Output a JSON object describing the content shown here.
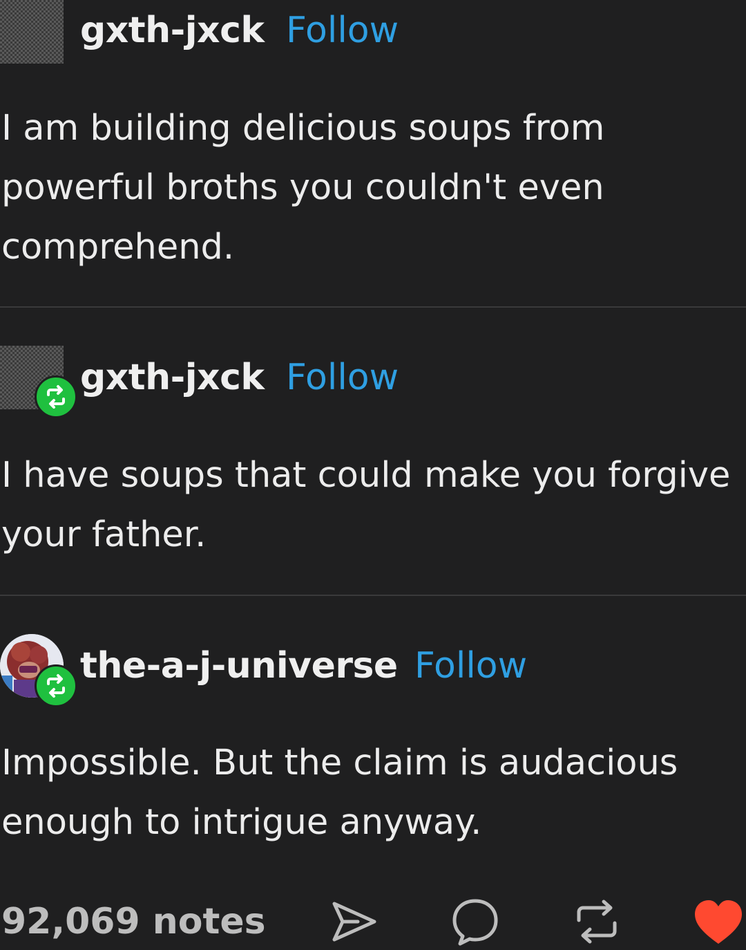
{
  "posts": [
    {
      "username": "gxth-jxck",
      "follow_label": "Follow",
      "text": "I am building delicious soups from powerful broths you couldn't even comprehend."
    },
    {
      "username": "gxth-jxck",
      "follow_label": "Follow",
      "text": "I have soups that could make you forgive your father."
    },
    {
      "username": "the-a-j-universe",
      "follow_label": "Follow",
      "text": "Impossible. But the claim is audacious enough to intrigue anyway."
    }
  ],
  "footer": {
    "notes": "92,069 notes",
    "icons": [
      "share-icon",
      "reply-icon",
      "reblog-icon",
      "like-icon"
    ]
  },
  "colors": {
    "background": "#1f1f20",
    "follow": "#2f9fe2",
    "reblog_badge": "#1fc03f",
    "like": "#ff4930"
  }
}
